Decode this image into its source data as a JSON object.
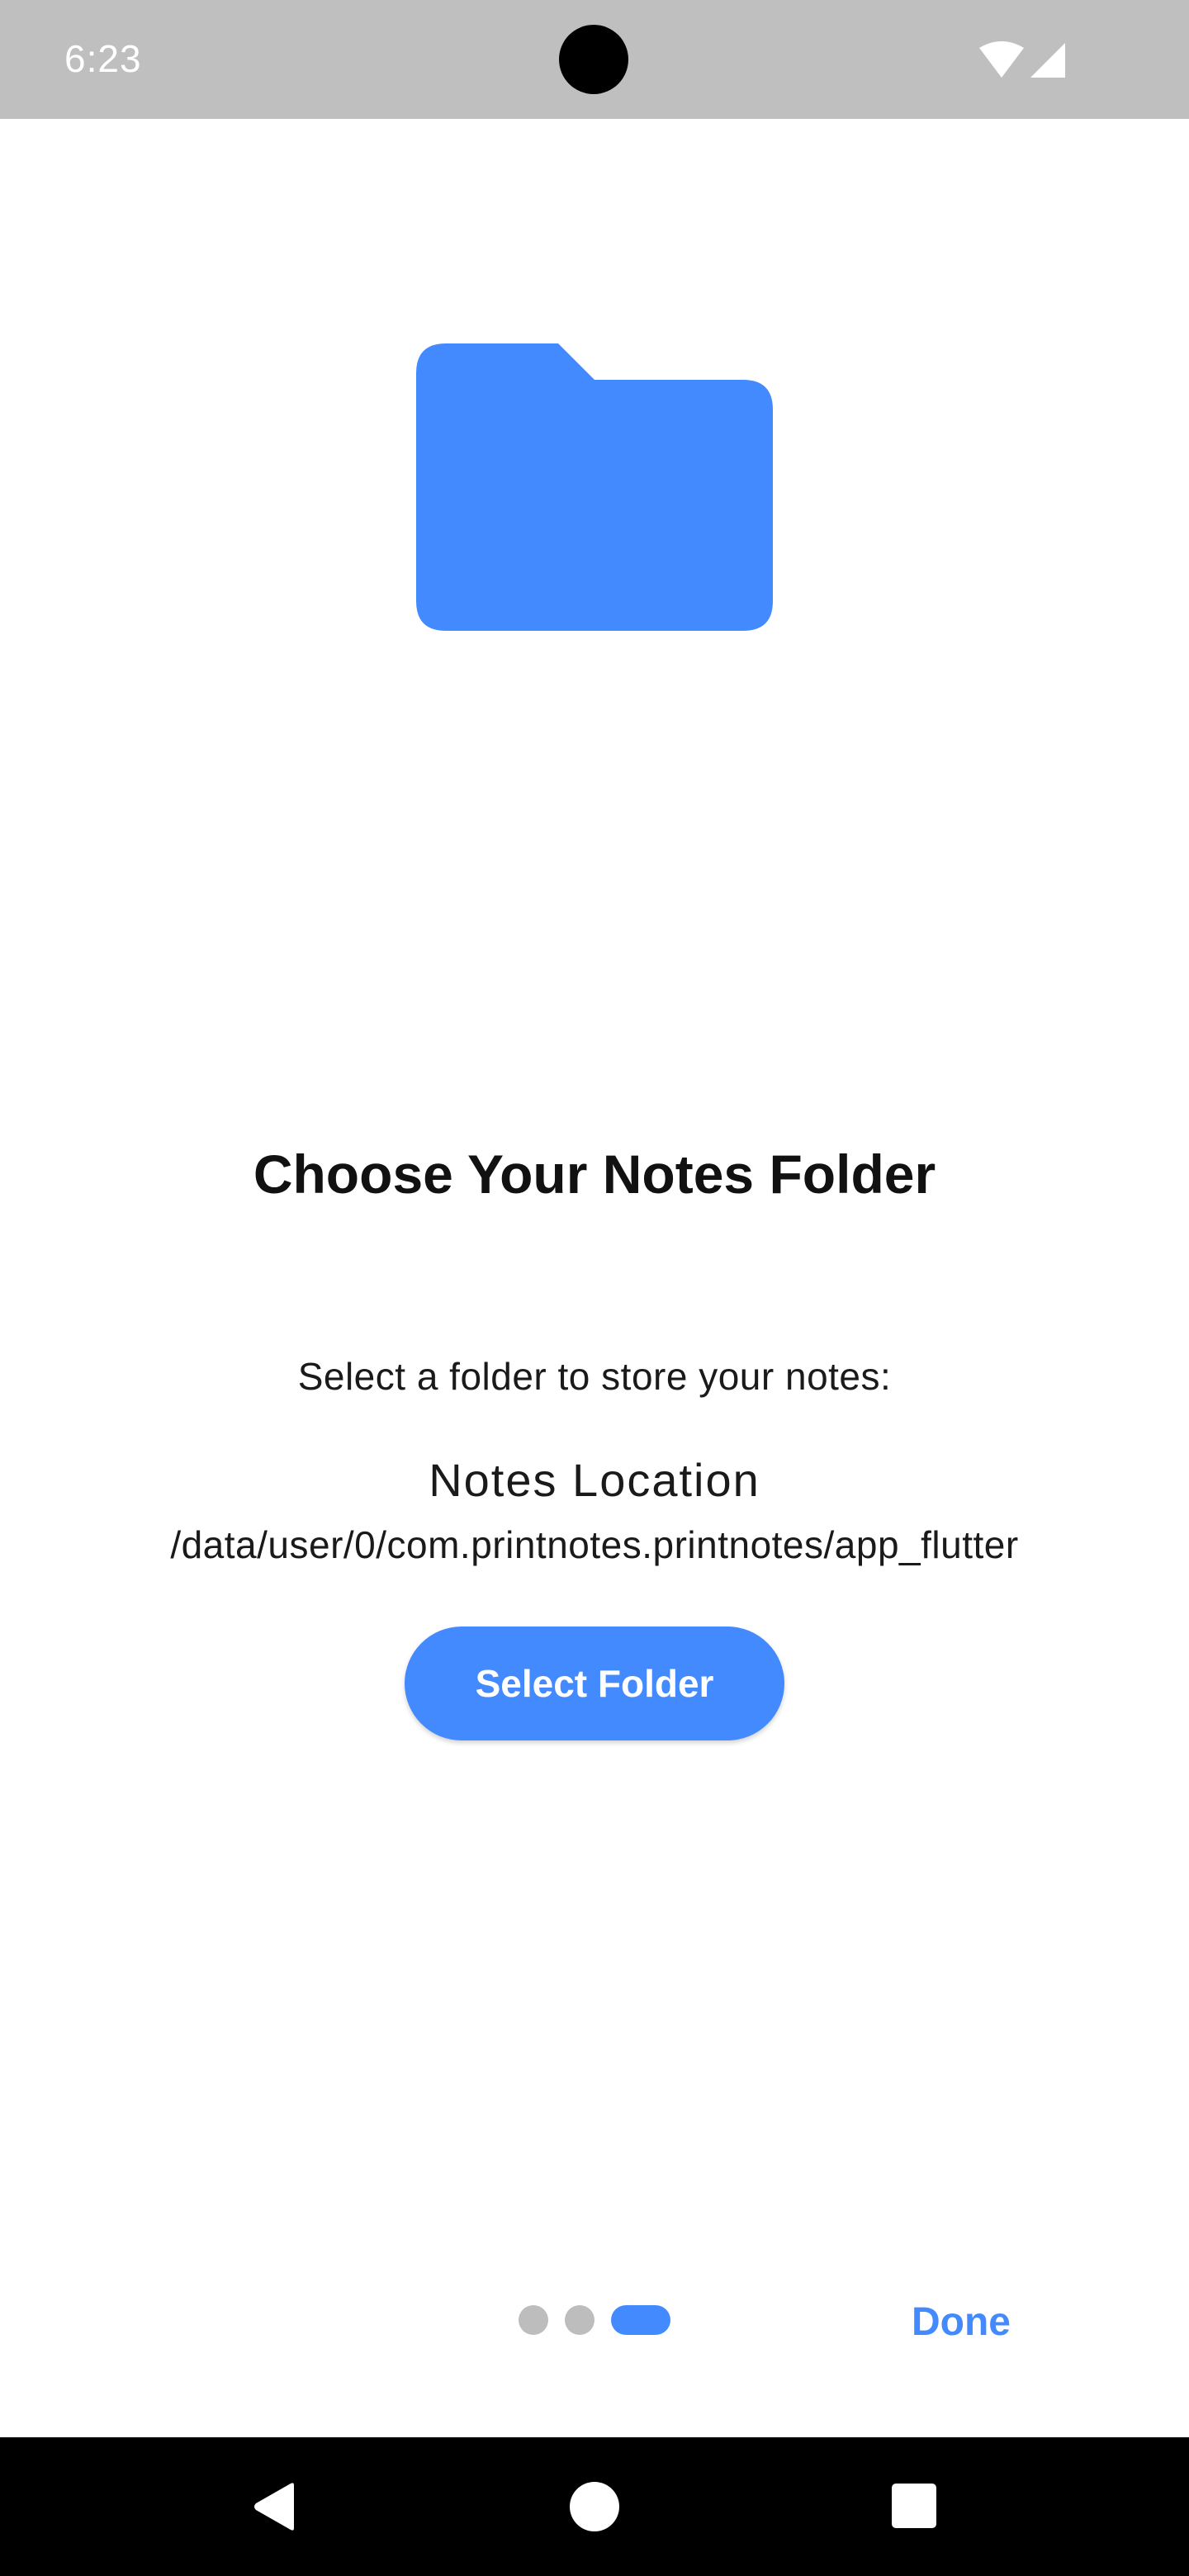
{
  "status_bar": {
    "time": "6:23",
    "icons": [
      "wifi-icon",
      "cellular-signal-icon"
    ]
  },
  "illustration": {
    "icon": "folder-icon",
    "color": "#448aff"
  },
  "content": {
    "title": "Choose Your Notes Folder",
    "subtitle": "Select a folder to store your notes:",
    "location_label": "Notes Location",
    "location_path": "/data/user/0/com.printnotes.printnotes/app_flutter",
    "select_button_label": "Select Folder"
  },
  "onboarding": {
    "total_pages": 3,
    "current_page": 3,
    "done_label": "Done"
  },
  "nav_bar": {
    "icons": [
      "back-icon",
      "home-icon",
      "recents-icon"
    ]
  },
  "colors": {
    "accent": "#448aff",
    "status_bar": "#bfbfbf",
    "inactive_dot": "#bdbdbd",
    "nav_bar": "#000000"
  }
}
